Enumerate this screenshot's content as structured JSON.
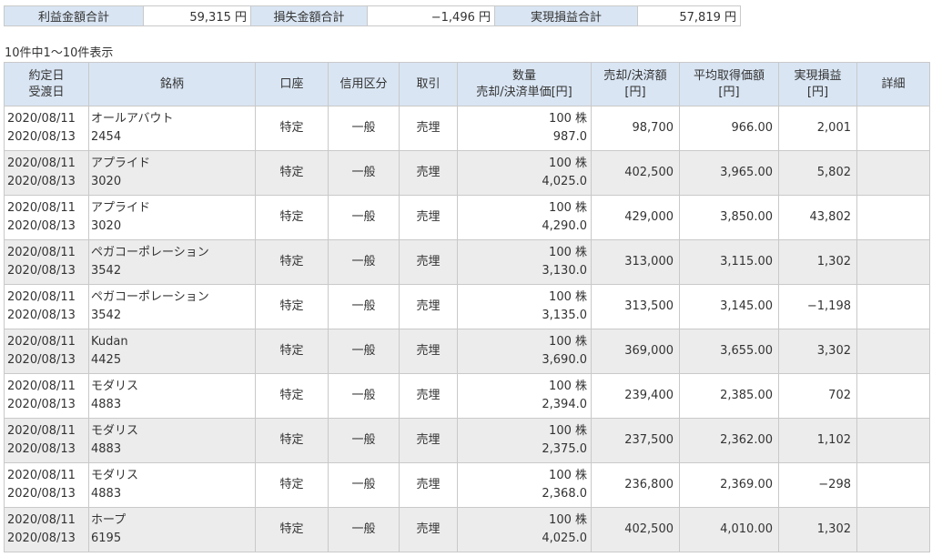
{
  "summary": {
    "profit_label": "利益金額合計",
    "profit_value": "59,315 円",
    "loss_label": "損失金額合計",
    "loss_value": "−1,496 円",
    "realized_label": "実現損益合計",
    "realized_value": "57,819 円"
  },
  "count_text": "10件中1〜10件表示",
  "table": {
    "headers": {
      "date_1": "約定日",
      "date_2": "受渡日",
      "stock": "銘柄",
      "account": "口座",
      "credit": "信用区分",
      "trade": "取引",
      "qty_1": "数量",
      "qty_2": "売却/決済単価[円]",
      "sell_1": "売却/決済額",
      "sell_2": "[円]",
      "avg_1": "平均取得価額",
      "avg_2": "[円]",
      "pnl_1": "実現損益",
      "pnl_2": "[円]",
      "detail": "詳細"
    },
    "rows": [
      {
        "trade_date": "2020/08/11",
        "settle_date": "2020/08/13",
        "name": "オールアバウト",
        "code": "2454",
        "account": "特定",
        "credit": "一般",
        "trade": "売埋",
        "qty": "100 株",
        "unit_price": "987.0",
        "amount": "98,700",
        "avg_cost": "966.00",
        "pnl": "2,001"
      },
      {
        "trade_date": "2020/08/11",
        "settle_date": "2020/08/13",
        "name": "アプライド",
        "code": "3020",
        "account": "特定",
        "credit": "一般",
        "trade": "売埋",
        "qty": "100 株",
        "unit_price": "4,025.0",
        "amount": "402,500",
        "avg_cost": "3,965.00",
        "pnl": "5,802"
      },
      {
        "trade_date": "2020/08/11",
        "settle_date": "2020/08/13",
        "name": "アプライド",
        "code": "3020",
        "account": "特定",
        "credit": "一般",
        "trade": "売埋",
        "qty": "100 株",
        "unit_price": "4,290.0",
        "amount": "429,000",
        "avg_cost": "3,850.00",
        "pnl": "43,802"
      },
      {
        "trade_date": "2020/08/11",
        "settle_date": "2020/08/13",
        "name": "ペガコーポレーション",
        "code": "3542",
        "account": "特定",
        "credit": "一般",
        "trade": "売埋",
        "qty": "100 株",
        "unit_price": "3,130.0",
        "amount": "313,000",
        "avg_cost": "3,115.00",
        "pnl": "1,302"
      },
      {
        "trade_date": "2020/08/11",
        "settle_date": "2020/08/13",
        "name": "ペガコーポレーション",
        "code": "3542",
        "account": "特定",
        "credit": "一般",
        "trade": "売埋",
        "qty": "100 株",
        "unit_price": "3,135.0",
        "amount": "313,500",
        "avg_cost": "3,145.00",
        "pnl": "−1,198"
      },
      {
        "trade_date": "2020/08/11",
        "settle_date": "2020/08/13",
        "name": "Kudan",
        "code": "4425",
        "account": "特定",
        "credit": "一般",
        "trade": "売埋",
        "qty": "100 株",
        "unit_price": "3,690.0",
        "amount": "369,000",
        "avg_cost": "3,655.00",
        "pnl": "3,302"
      },
      {
        "trade_date": "2020/08/11",
        "settle_date": "2020/08/13",
        "name": "モダリス",
        "code": "4883",
        "account": "特定",
        "credit": "一般",
        "trade": "売埋",
        "qty": "100 株",
        "unit_price": "2,394.0",
        "amount": "239,400",
        "avg_cost": "2,385.00",
        "pnl": "702"
      },
      {
        "trade_date": "2020/08/11",
        "settle_date": "2020/08/13",
        "name": "モダリス",
        "code": "4883",
        "account": "特定",
        "credit": "一般",
        "trade": "売埋",
        "qty": "100 株",
        "unit_price": "2,375.0",
        "amount": "237,500",
        "avg_cost": "2,362.00",
        "pnl": "1,102"
      },
      {
        "trade_date": "2020/08/11",
        "settle_date": "2020/08/13",
        "name": "モダリス",
        "code": "4883",
        "account": "特定",
        "credit": "一般",
        "trade": "売埋",
        "qty": "100 株",
        "unit_price": "2,368.0",
        "amount": "236,800",
        "avg_cost": "2,369.00",
        "pnl": "−298"
      },
      {
        "trade_date": "2020/08/11",
        "settle_date": "2020/08/13",
        "name": "ホープ",
        "code": "6195",
        "account": "特定",
        "credit": "一般",
        "trade": "売埋",
        "qty": "100 株",
        "unit_price": "4,025.0",
        "amount": "402,500",
        "avg_cost": "4,010.00",
        "pnl": "1,302"
      }
    ]
  }
}
